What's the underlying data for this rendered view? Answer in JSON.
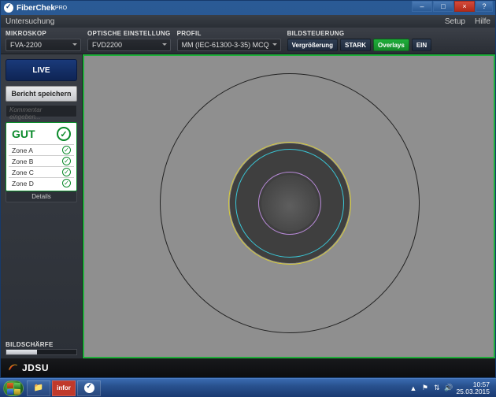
{
  "window": {
    "app_name": "FiberChek",
    "app_suffix": "PRO",
    "min": "–",
    "max": "□",
    "close": "×",
    "help": "?"
  },
  "menubar": {
    "investigation": "Untersuchung",
    "setup": "Setup",
    "help": "Hilfe"
  },
  "toolbar": {
    "microscope_label": "MIKROSKOP",
    "microscope_value": "FVA-2200",
    "optical_label": "OPTISCHE EINSTELLUNG",
    "optical_value": "FVD2200",
    "profile_label": "PROFIL",
    "profile_value": "MM (IEC-61300-3-35) MCQ",
    "image_ctrl_label": "BILDSTEUERUNG",
    "mag_label": "Vergrößerung",
    "stark_label": "STARK",
    "overlays_label": "Overlays",
    "on_label": "EIN"
  },
  "sidebar": {
    "live": "LIVE",
    "save_report": "Bericht speichern",
    "comment_placeholder": "Kommentar eingeben...",
    "status_text": "GUT",
    "zones": [
      {
        "label": "Zone A"
      },
      {
        "label": "Zone B"
      },
      {
        "label": "Zone C"
      },
      {
        "label": "Zone D"
      }
    ],
    "details": "Details",
    "sharpness_label": "BILDSCHÄRFE"
  },
  "footer": {
    "brand": "JDSU"
  },
  "taskbar": {
    "infor": "infor",
    "time": "10:57",
    "date": "25.03.2015"
  }
}
